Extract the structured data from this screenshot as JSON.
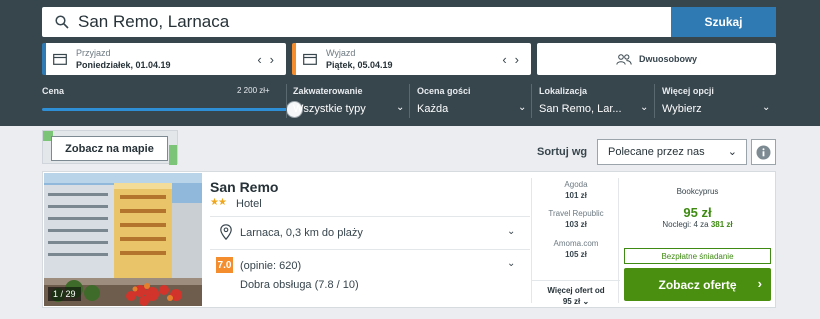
{
  "search": {
    "value": "San Remo, Larnaca",
    "button_label": "Szukaj",
    "icon": "search-icon"
  },
  "checkin": {
    "label": "Przyjazd",
    "value": "Poniedziałek, 01.04.19",
    "accent": "#2f7ab2",
    "icon": "calendar-icon"
  },
  "checkout": {
    "label": "Wyjazd",
    "value": "Piątek, 05.04.19",
    "accent": "#f38d2e",
    "icon": "calendar-icon"
  },
  "guests": {
    "value": "Dwuosobowy",
    "icon": "users-icon"
  },
  "filters": {
    "price": {
      "label": "Cena",
      "max_value": "2 200 zł+",
      "slider_fraction": 1.0
    },
    "accommodation": {
      "label": "Zakwaterowanie",
      "value": "Wszystkie typy"
    },
    "rating": {
      "label": "Ocena gości",
      "value": "Każda"
    },
    "location": {
      "label": "Lokalizacja",
      "value": "San Remo, Lar..."
    },
    "more": {
      "label": "Więcej opcji",
      "value": "Wybierz"
    }
  },
  "map": {
    "button_label": "Zobacz na mapie"
  },
  "sort": {
    "label": "Sortuj wg",
    "value": "Polecane przez nas"
  },
  "hotel": {
    "name": "San Remo",
    "stars": 2,
    "type": "Hotel",
    "photo_counter": "1 / 29",
    "location": "Larnaca, 0,3 km do plaży",
    "score": "7.0",
    "reviews": "(opinie: 620)",
    "service": "Dobra obsługa (7.8 / 10)"
  },
  "offers": [
    {
      "provider": "Agoda",
      "price": "101 zł"
    },
    {
      "provider": "Travel Republic",
      "price": "103 zł"
    },
    {
      "provider": "Amoma.com",
      "price": "105 zł"
    }
  ],
  "more_offers": {
    "line1": "Więcej ofert od",
    "line2": "95 zł"
  },
  "best_deal": {
    "provider": "Bookcyprus",
    "price": "95 zł",
    "nights_prefix": "Noclegi: 4 za",
    "nights_total": "381 zł",
    "badge": "Bezpłatne śniadanie",
    "button_label": "Zobacz ofertę",
    "accent": "#4a8f0f"
  }
}
